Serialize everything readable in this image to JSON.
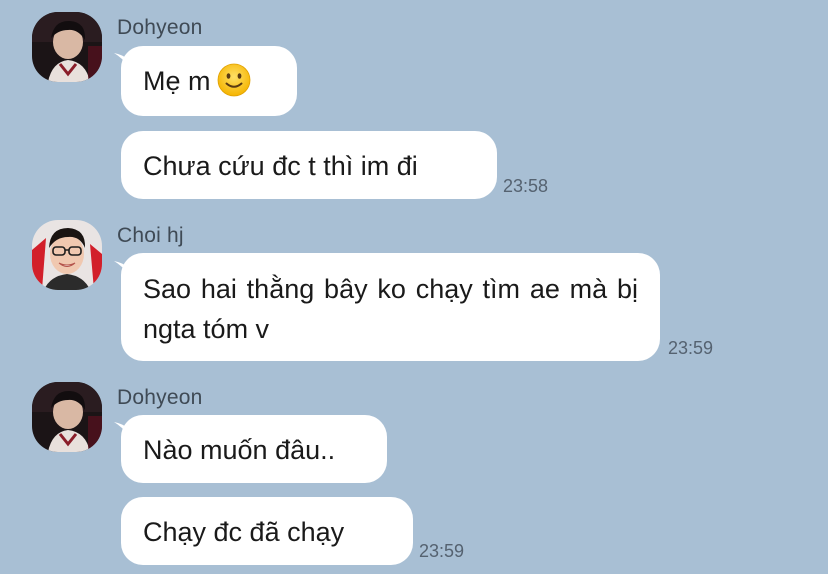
{
  "groups": [
    {
      "sender": "Dohyeon",
      "avatar_icon": "avatar-dohyeon",
      "messages": [
        {
          "text": "Mẹ m",
          "emoji": "slightly-smiling-face-icon"
        },
        {
          "text": "Chưa cứu đc t thì im đi",
          "time": "23:58"
        }
      ]
    },
    {
      "sender": "Choi hj",
      "avatar_icon": "avatar-choi-hj",
      "messages": [
        {
          "text": "Sao hai thằng bây ko chạy tìm ae mà bị ngta tóm v",
          "time": "23:59"
        }
      ]
    },
    {
      "sender": "Dohyeon",
      "avatar_icon": "avatar-dohyeon",
      "messages": [
        {
          "text": "Nào muốn đâu.."
        },
        {
          "text": "Chạy đc đã chạy",
          "time": "23:59"
        }
      ]
    }
  ],
  "colors": {
    "background": "#a8bfd4",
    "bubble": "#ffffff",
    "sender_text": "#3f4a55",
    "timestamp_text": "#556270"
  }
}
